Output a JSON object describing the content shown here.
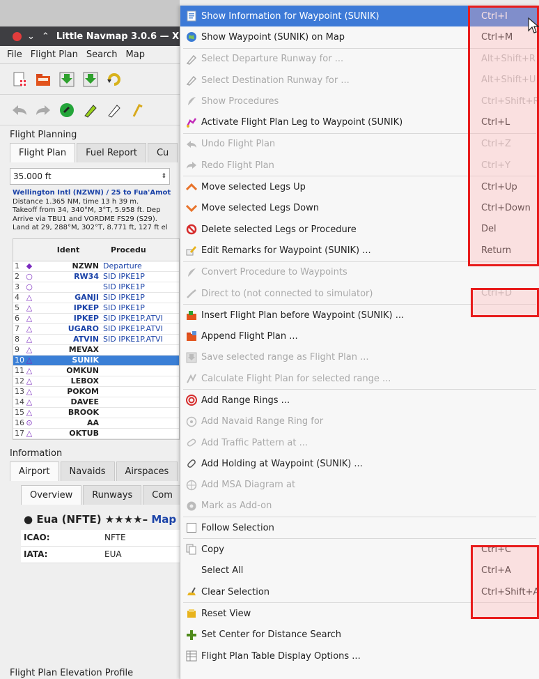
{
  "app": {
    "title": "Little Navmap 3.0.6 — X",
    "menubar": [
      "File",
      "Flight Plan",
      "Search",
      "Map"
    ],
    "flight_planning_title": "Flight Planning",
    "tabs": [
      "Flight Plan",
      "Fuel Report",
      "Cu"
    ],
    "altitude": "35.000 ft",
    "route_lines": [
      "Wellington Intl (NZWN) / 25 to Fua'Amot",
      "Distance 1.365 NM, time 13 h 39 m.",
      "Takeoff from 34, 340°M, 3°T, 5.958 ft. Dep",
      "Arrive via TBU1 and VORDME FS29 (S29).",
      "Land at 29, 288°M, 302°T, 8.771 ft, 127 ft el"
    ],
    "grid_headers": [
      "Ident",
      "Procedu"
    ],
    "rows": [
      {
        "n": "1",
        "sym": "◆",
        "ident": "NZWN",
        "proc": "Departure",
        "blue": false
      },
      {
        "n": "2",
        "sym": "○",
        "ident": "RW34",
        "proc": "SID IPKE1P",
        "blue": true
      },
      {
        "n": "3",
        "sym": "○",
        "ident": "",
        "proc": "SID IPKE1P",
        "blue": false
      },
      {
        "n": "4",
        "sym": "△",
        "ident": "GANJI",
        "proc": "SID IPKE1P",
        "blue": true
      },
      {
        "n": "5",
        "sym": "△",
        "ident": "IPKEP",
        "proc": "SID IPKE1P",
        "blue": true
      },
      {
        "n": "6",
        "sym": "△",
        "ident": "IPKEP",
        "proc": "SID IPKE1P.ATVI",
        "blue": true
      },
      {
        "n": "7",
        "sym": "△",
        "ident": "UGARO",
        "proc": "SID IPKE1P.ATVI",
        "blue": true
      },
      {
        "n": "8",
        "sym": "△",
        "ident": "ATVIN",
        "proc": "SID IPKE1P.ATVI",
        "blue": true
      },
      {
        "n": "9",
        "sym": "△",
        "ident": "MEVAX",
        "proc": "",
        "blue": false
      },
      {
        "n": "10",
        "sym": "△",
        "ident": "SUNIK",
        "proc": "",
        "blue": false,
        "selected": true
      },
      {
        "n": "11",
        "sym": "△",
        "ident": "OMKUN",
        "proc": "",
        "blue": false
      },
      {
        "n": "12",
        "sym": "△",
        "ident": "LEBOX",
        "proc": "",
        "blue": false
      },
      {
        "n": "13",
        "sym": "△",
        "ident": "POKOM",
        "proc": "",
        "blue": false
      },
      {
        "n": "14",
        "sym": "△",
        "ident": "DAVEE",
        "proc": "",
        "blue": false
      },
      {
        "n": "15",
        "sym": "△",
        "ident": "BROOK",
        "proc": "",
        "blue": false
      },
      {
        "n": "16",
        "sym": "⊙",
        "ident": "AA",
        "proc": "",
        "blue": false
      },
      {
        "n": "17",
        "sym": "△",
        "ident": "OKTUB",
        "proc": "",
        "blue": false
      }
    ],
    "information_title": "Information",
    "info_tabs": [
      "Airport",
      "Navaids",
      "Airspaces"
    ],
    "sub_tabs": [
      "Overview",
      "Runways",
      "Com"
    ],
    "airport_name": "Eua (NFTE) ★★★★–",
    "airport_map_link": "Map",
    "icao_label": "ICAO:",
    "icao_value": "NFTE",
    "iata_label": "IATA:",
    "iata_value": "EUA",
    "profile_title": "Flight Plan Elevation Profile"
  },
  "menu": {
    "items": [
      {
        "label": "Show Information for Waypoint (SUNIK)",
        "shortcut": "Ctrl+I",
        "icon": "info-page-icon",
        "state": "highlight"
      },
      {
        "label": "Show Waypoint (SUNIK) on Map",
        "shortcut": "Ctrl+M",
        "icon": "globe-icon",
        "state": "enabled"
      },
      {
        "label": "Select Departure Runway for ...",
        "shortcut": "Alt+Shift+R",
        "icon": "runway-icon",
        "state": "disabled"
      },
      {
        "label": "Select Destination Runway for ...",
        "shortcut": "Alt+Shift+U",
        "icon": "runway-icon",
        "state": "disabled"
      },
      {
        "label": "Show Procedures",
        "shortcut": "Ctrl+Shift+R",
        "icon": "procedure-icon",
        "state": "disabled"
      },
      {
        "label": "Activate Flight Plan Leg to Waypoint (SUNIK)",
        "shortcut": "Ctrl+L",
        "icon": "activate-leg-icon",
        "state": "enabled"
      },
      {
        "label": "Undo Flight Plan",
        "shortcut": "Ctrl+Z",
        "icon": "undo-icon",
        "state": "disabled"
      },
      {
        "label": "Redo Flight Plan",
        "shortcut": "Ctrl+Y",
        "icon": "redo-icon",
        "state": "disabled"
      },
      {
        "label": "Move selected Legs Up",
        "shortcut": "Ctrl+Up",
        "icon": "arrow-up-icon",
        "state": "enabled"
      },
      {
        "label": "Move selected Legs Down",
        "shortcut": "Ctrl+Down",
        "icon": "arrow-down-icon",
        "state": "enabled"
      },
      {
        "label": "Delete selected Legs or Procedure",
        "shortcut": "Del",
        "icon": "delete-icon",
        "state": "enabled"
      },
      {
        "label": "Edit Remarks for Waypoint (SUNIK) ...",
        "shortcut": "Return",
        "icon": "edit-remarks-icon",
        "state": "enabled"
      },
      {
        "label": "Convert Procedure to Waypoints",
        "shortcut": "",
        "icon": "convert-icon",
        "state": "disabled"
      },
      {
        "label": "Direct to  (not connected to simulator)",
        "shortcut": "Ctrl+D",
        "icon": "direct-to-icon",
        "state": "disabled"
      },
      {
        "label": "Insert Flight Plan before Waypoint (SUNIK) ...",
        "shortcut": "",
        "icon": "insert-plan-icon",
        "state": "enabled"
      },
      {
        "label": "Append Flight Plan ...",
        "shortcut": "",
        "icon": "append-plan-icon",
        "state": "enabled"
      },
      {
        "label": "Save selected range as Flight Plan ...",
        "shortcut": "",
        "icon": "save-range-icon",
        "state": "disabled"
      },
      {
        "label": "Calculate Flight Plan for selected range ...",
        "shortcut": "",
        "icon": "calculate-icon",
        "state": "disabled"
      },
      {
        "label": "Add Range Rings ...",
        "shortcut": "",
        "icon": "range-rings-icon",
        "state": "enabled"
      },
      {
        "label": "Add Navaid Range Ring for",
        "shortcut": "",
        "icon": "navaid-ring-icon",
        "state": "disabled"
      },
      {
        "label": "Add Traffic Pattern at ...",
        "shortcut": "",
        "icon": "traffic-pattern-icon",
        "state": "disabled"
      },
      {
        "label": "Add Holding at Waypoint (SUNIK) ...",
        "shortcut": "",
        "icon": "holding-icon",
        "state": "enabled"
      },
      {
        "label": "Add MSA Diagram at",
        "shortcut": "",
        "icon": "msa-icon",
        "state": "disabled"
      },
      {
        "label": "Mark  as Add-on",
        "shortcut": "",
        "icon": "addon-icon",
        "state": "disabled"
      },
      {
        "label": "Follow Selection",
        "shortcut": "",
        "icon": "checkbox-icon",
        "state": "enabled"
      },
      {
        "label": "Copy",
        "shortcut": "Ctrl+C",
        "icon": "copy-icon",
        "state": "enabled"
      },
      {
        "label": "Select All",
        "shortcut": "Ctrl+A",
        "icon": "",
        "state": "enabled"
      },
      {
        "label": "Clear Selection",
        "shortcut": "Ctrl+Shift+A",
        "icon": "clear-selection-icon",
        "state": "enabled"
      },
      {
        "label": "Reset View",
        "shortcut": "",
        "icon": "reset-view-icon",
        "state": "enabled"
      },
      {
        "label": "Set Center for Distance Search",
        "shortcut": "",
        "icon": "center-cross-icon",
        "state": "enabled"
      },
      {
        "label": "Flight Plan Table Display Options ...",
        "shortcut": "",
        "icon": "table-options-icon",
        "state": "enabled"
      }
    ],
    "separators_after": [
      1,
      5,
      7,
      11,
      13,
      17,
      23,
      24,
      27
    ],
    "accent": "#3d7ad7",
    "highlight_box_color": "#e81c1c"
  }
}
